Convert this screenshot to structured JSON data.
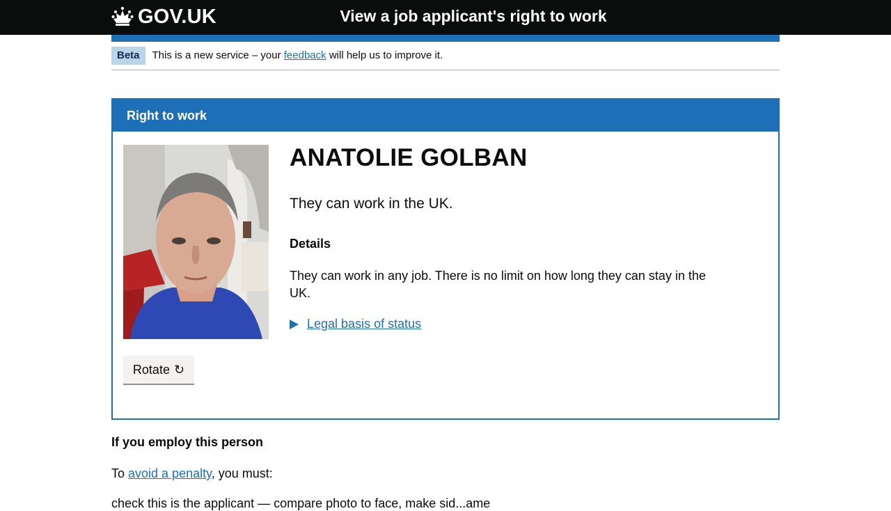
{
  "header": {
    "logo_text": "GOV.UK",
    "service_name": "View a job applicant's right to work"
  },
  "phase_banner": {
    "tag": "Beta",
    "text_before": "This is a new service – your ",
    "link_text": "feedback",
    "text_after": " will help us to improve it."
  },
  "panel": {
    "title": "Right to work",
    "person_name": "ANATOLIE GOLBAN",
    "status": "They can work in the UK.",
    "details_heading": "Details",
    "details_text": "They can work in any job. There is no limit on how long they can stay in the UK.",
    "legal_basis_label": "Legal basis of status",
    "rotate_label": "Rotate",
    "rotate_icon": "↻"
  },
  "employ_section": {
    "heading": "If you employ this person",
    "text_before": "To ",
    "link_text": "avoid a penalty",
    "text_after": ", you must:",
    "partial_line": "check this is the applicant — compare photo to face, make sid...ame"
  },
  "colors": {
    "header_bg": "#0b0c0c",
    "brand_blue": "#1d70b8",
    "tag_bg": "#bbd4ea",
    "button_bg": "#f3f2f1"
  }
}
